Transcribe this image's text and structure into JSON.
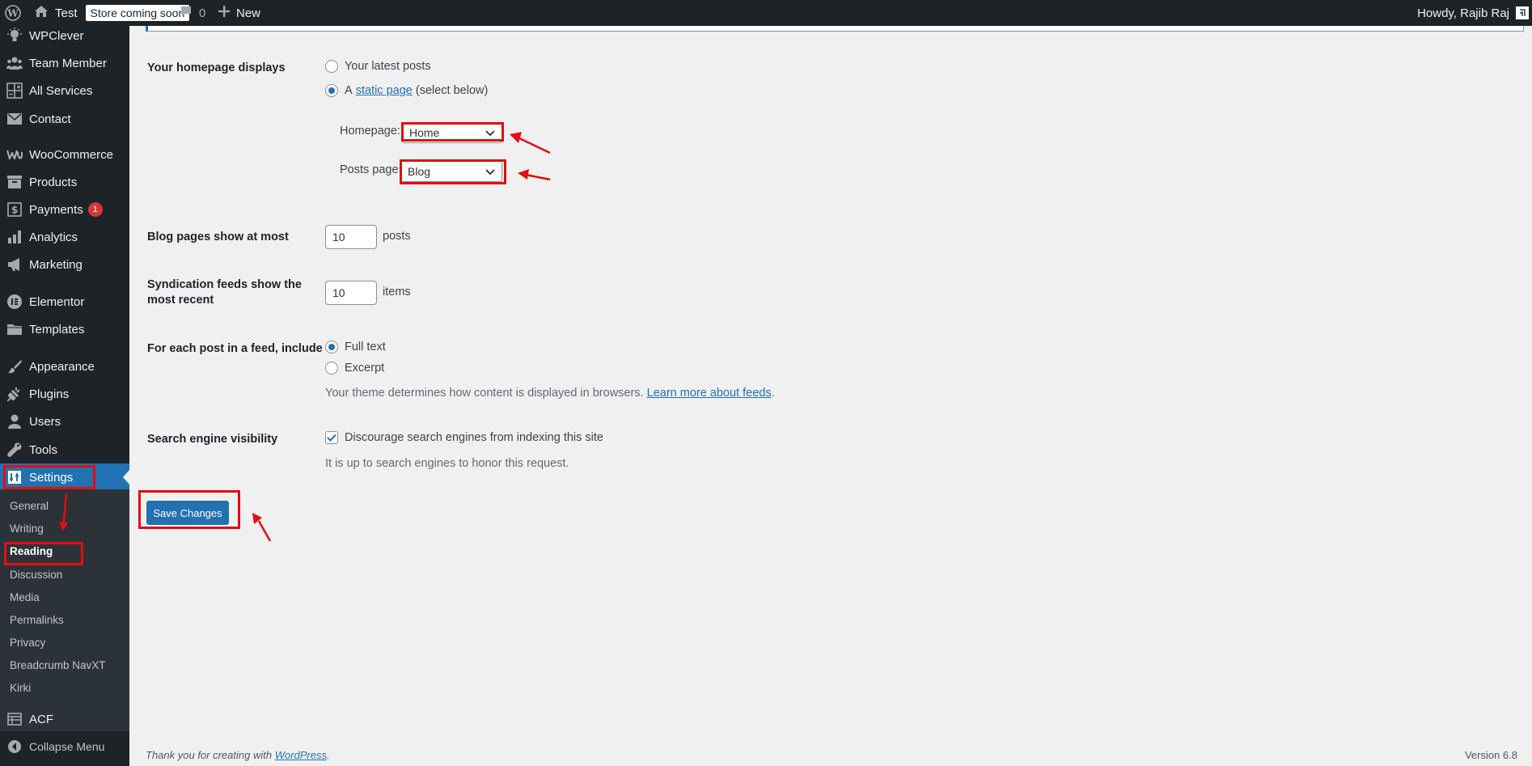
{
  "adminbar": {
    "site_name": "Test",
    "store_badge": "Store coming soon",
    "comments_count": "0",
    "new_label": "New",
    "howdy": "Howdy, Rajib Raj"
  },
  "sidebar": {
    "items": [
      {
        "label": "WPClever",
        "icon": "lightbulb-icon"
      },
      {
        "label": "Team Member",
        "icon": "team-icon"
      },
      {
        "label": "All Services",
        "icon": "grid-icon"
      },
      {
        "label": "Contact",
        "icon": "mail-icon"
      },
      {
        "label": "WooCommerce",
        "icon": "woocommerce-icon"
      },
      {
        "label": "Products",
        "icon": "archive-icon"
      },
      {
        "label": "Payments",
        "icon": "dollar-icon",
        "badge": "1"
      },
      {
        "label": "Analytics",
        "icon": "bar-chart-icon"
      },
      {
        "label": "Marketing",
        "icon": "megaphone-icon"
      },
      {
        "label": "Elementor",
        "icon": "elementor-icon"
      },
      {
        "label": "Templates",
        "icon": "folder-icon"
      },
      {
        "label": "Appearance",
        "icon": "brush-icon"
      },
      {
        "label": "Plugins",
        "icon": "plug-icon"
      },
      {
        "label": "Users",
        "icon": "user-icon"
      },
      {
        "label": "Tools",
        "icon": "wrench-icon"
      },
      {
        "label": "Settings",
        "icon": "settings-icon"
      },
      {
        "label": "ACF",
        "icon": "acf-icon"
      },
      {
        "label": "Collapse Menu",
        "icon": "collapse-icon"
      }
    ],
    "submenu": [
      "General",
      "Writing",
      "Reading",
      "Discussion",
      "Media",
      "Permalinks",
      "Privacy",
      "Breadcrumb NavXT",
      "Kirki"
    ]
  },
  "reading": {
    "homepage_displays_label": "Your homepage displays",
    "latest_posts_label": "Your latest posts",
    "static_a": "A",
    "static_link": "static page",
    "static_suffix": "(select below)",
    "homepage_label": "Homepage:",
    "homepage_value": "Home",
    "posts_page_label": "Posts page:",
    "posts_page_value": "Blog",
    "blog_pages_label": "Blog pages show at most",
    "blog_pages_value": "10",
    "blog_pages_unit": "posts",
    "syndication_label_1": "Syndication feeds show the",
    "syndication_label_2": "most recent",
    "syndication_value": "10",
    "syndication_unit": "items",
    "feed_include_label": "For each post in a feed, include",
    "full_text_label": "Full text",
    "excerpt_label": "Excerpt",
    "theme_desc": "Your theme determines how content is displayed in browsers.",
    "learn_more": "Learn more about feeds",
    "learn_more_period": ".",
    "search_visibility_label": "Search engine visibility",
    "discourage_label": "Discourage search engines from indexing this site",
    "honor_desc": "It is up to search engines to honor this request.",
    "save_button": "Save Changes"
  },
  "footer": {
    "thanks_prefix": "Thank you for creating with",
    "wordpress_link": "WordPress",
    "thanks_suffix": ".",
    "version": "Version 6.8"
  },
  "colors": {
    "admin_dark": "#1d2327",
    "accent": "#2271b1",
    "annotation_red": "#e10f0f"
  }
}
